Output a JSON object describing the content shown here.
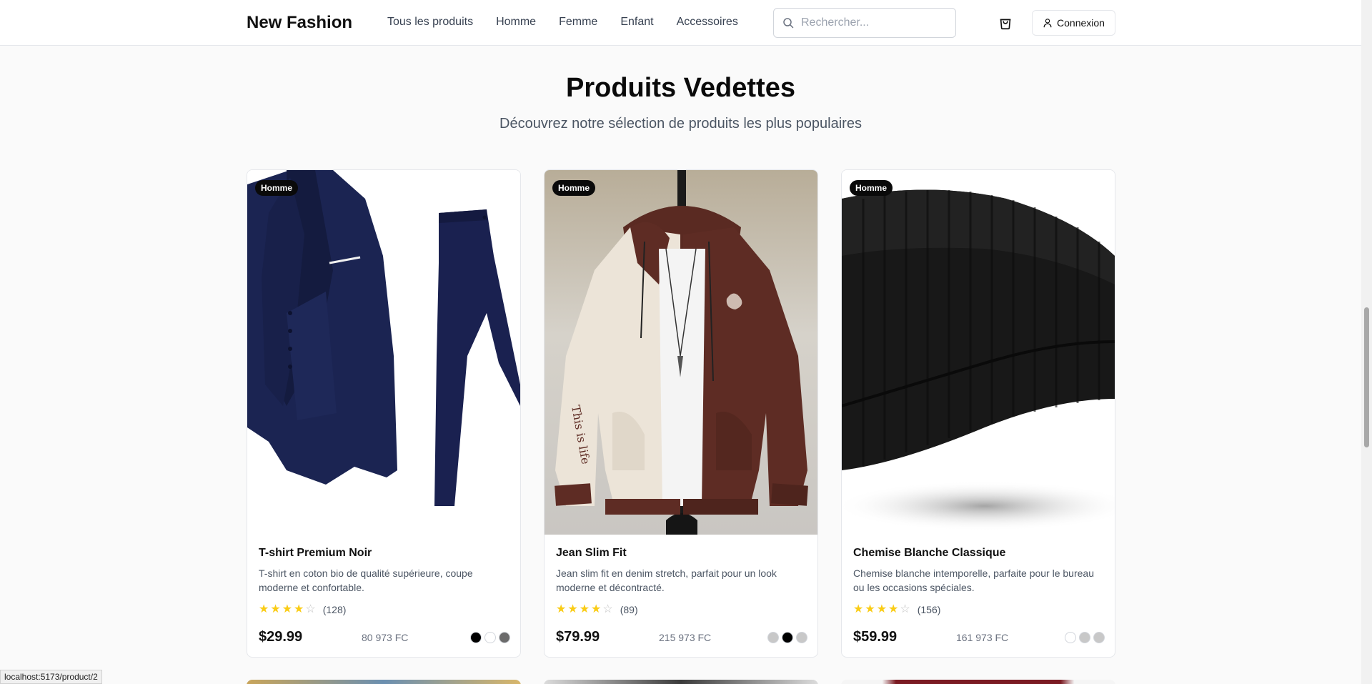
{
  "header": {
    "logo": "New Fashion",
    "nav": [
      "Tous les produits",
      "Homme",
      "Femme",
      "Enfant",
      "Accessoires"
    ],
    "search_placeholder": "Rechercher...",
    "login_label": "Connexion"
  },
  "section": {
    "title": "Produits Vedettes",
    "subtitle": "Découvrez notre sélection de produits les plus populaires"
  },
  "products": [
    {
      "badge": "Homme",
      "name": "T-shirt Premium Noir",
      "description": "T-shirt en coton bio de qualité supérieure, coupe moderne et confortable.",
      "rating": 4,
      "reviews": "(128)",
      "price": "$29.99",
      "price_fc": "80 973 FC",
      "colors": [
        "#000000",
        "#ffffff",
        "#6b6b6b"
      ]
    },
    {
      "badge": "Homme",
      "name": "Jean Slim Fit",
      "description": "Jean slim fit en denim stretch, parfait pour un look moderne et décontracté.",
      "rating": 4,
      "reviews": "(89)",
      "price": "$79.99",
      "price_fc": "215 973 FC",
      "colors": [
        "#c8c8c8",
        "#000000",
        "#c8c8c8"
      ]
    },
    {
      "badge": "Homme",
      "name": "Chemise Blanche Classique",
      "description": "Chemise blanche intemporelle, parfaite pour le bureau ou les occasions spéciales.",
      "rating": 4,
      "reviews": "(156)",
      "price": "$59.99",
      "price_fc": "161 973 FC",
      "colors": [
        "#ffffff",
        "#c8c8c8",
        "#c8c8c8"
      ]
    }
  ],
  "status_url": "localhost:5173/product/2"
}
